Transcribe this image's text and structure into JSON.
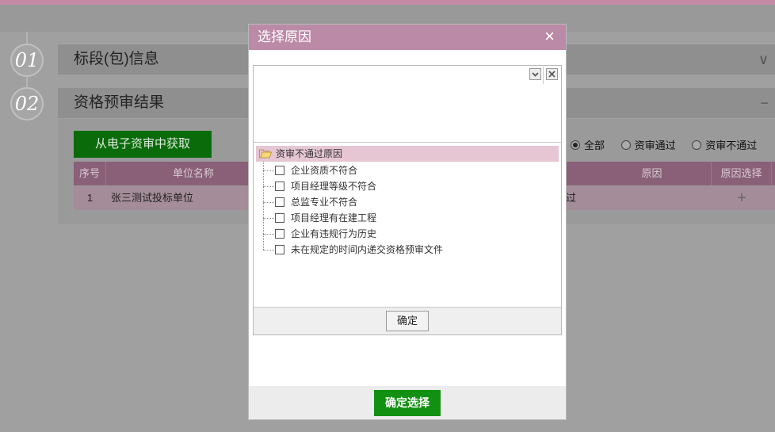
{
  "steps": [
    {
      "number": "01",
      "title": "标段(包)信息",
      "toggle": "∨"
    },
    {
      "number": "02",
      "title": "资格预审结果",
      "toggle": "−"
    }
  ],
  "actions": {
    "fetch_label": "从电子资审中获取"
  },
  "filters": {
    "all": "全部",
    "pass": "资审通过",
    "fail": "资审不通过",
    "selected": "all"
  },
  "table": {
    "headers": {
      "index": "序号",
      "unit": "单位名称",
      "reason": "原因",
      "reason_select": "原因选择"
    },
    "rows": [
      {
        "index": "1",
        "unit": "张三测试投标单位",
        "status_partial": "过",
        "action": "+"
      }
    ]
  },
  "modal": {
    "title": "选择原因",
    "close": "×",
    "dropdown_icon": "chevron-down-icon",
    "clear_icon": "close-icon",
    "tree": {
      "root": "资审不通过原因",
      "items": [
        "企业资质不符合",
        "项目经理等级不符合",
        "总监专业不符合",
        "项目经理有在建工程",
        "企业有违规行为历史",
        "未在规定的时间内递交资格预审文件"
      ]
    },
    "inner_ok": "确定",
    "confirm": "确定选择"
  },
  "colors": {
    "title_bar": "#bb8aa6",
    "confirm": "#129012",
    "tree_root_bg": "#e6c6d3"
  }
}
